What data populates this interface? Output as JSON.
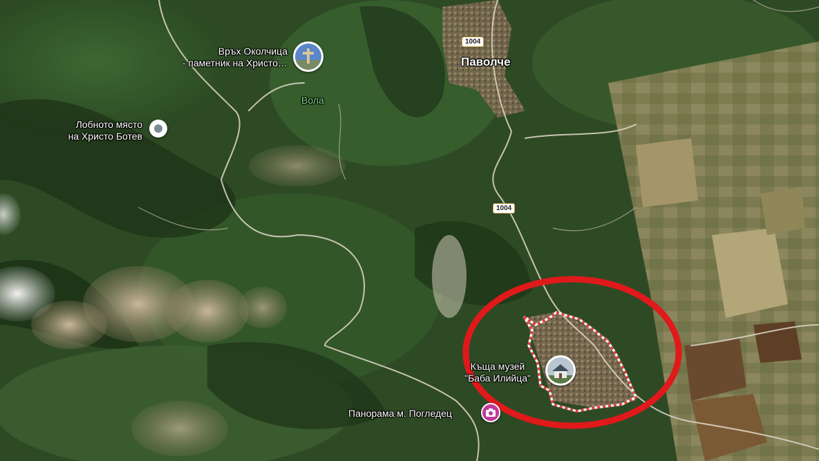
{
  "map": {
    "type": "satellite",
    "places": {
      "peak": {
        "line1": "Връх Околчица",
        "line2": "- паметник на Христо…"
      },
      "vola": "Вола",
      "lobnoto": {
        "line1": "Лобното място",
        "line2": "на Христо Ботев"
      },
      "pavolche": "Паволче",
      "museum": {
        "line1": "Къща музей",
        "line2": "\"Баба Илийца\""
      },
      "panorama": "Панорама м. Погледец"
    },
    "roads": {
      "shield_top": "1004",
      "shield_mid": "1004"
    },
    "icons": {
      "peak_pin": "cross-monument-photo-icon",
      "lobnoto_pin": "place-dot-icon",
      "museum_pin": "house-photo-icon",
      "panorama_pin": "camera-icon"
    },
    "colors": {
      "annotation_ring": "#e0191b",
      "village_boundary": "#e23b3b",
      "road_shield_border": "#c9a24a",
      "camera_pin": "#c0399a"
    }
  }
}
